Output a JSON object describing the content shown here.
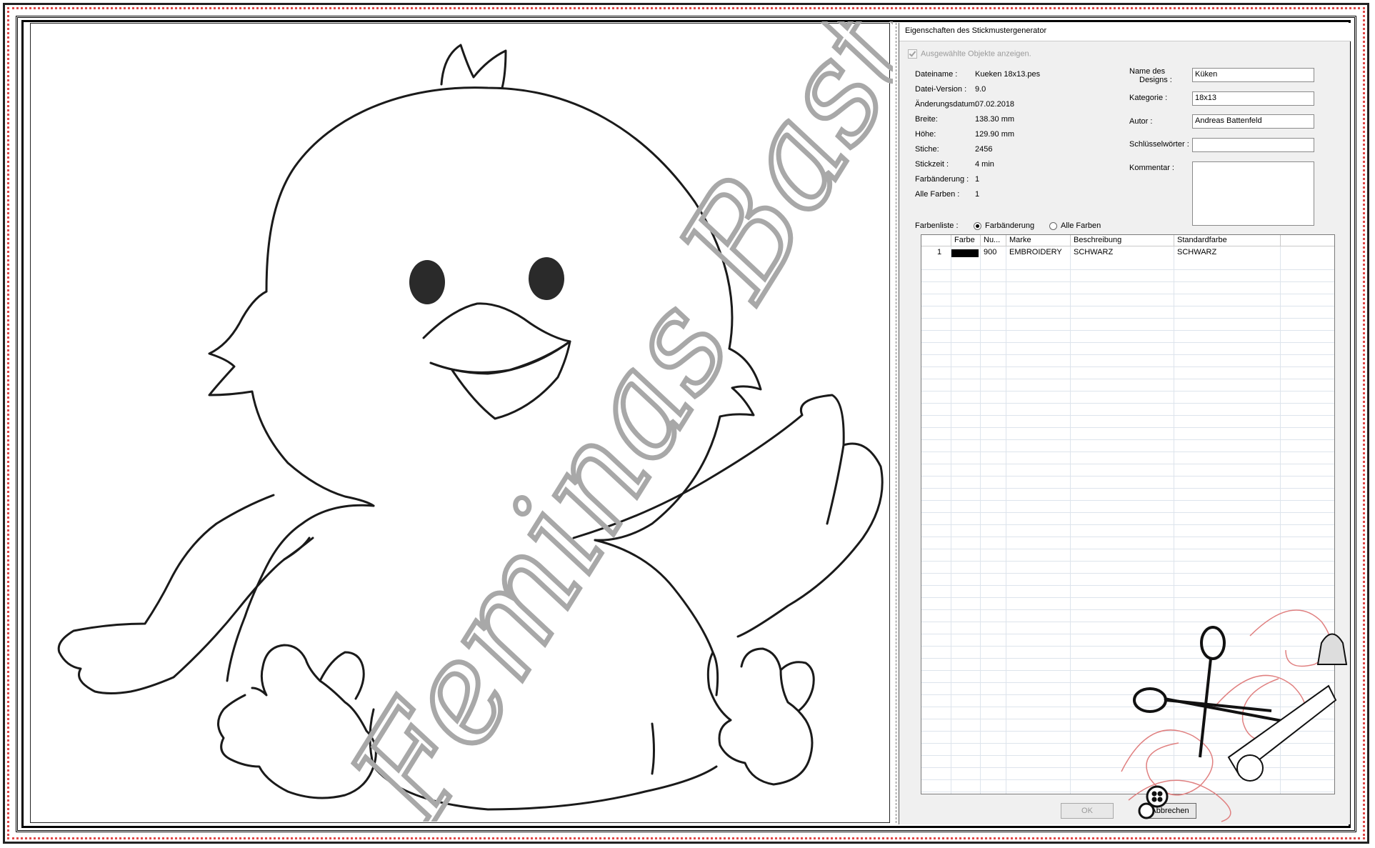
{
  "dialog": {
    "title": "Eigenschaften des Stickmustergenerator",
    "show_selected_label": "Ausgewählte Objekte anzeigen.",
    "info": [
      {
        "label": "Dateiname :",
        "value": "Kueken 18x13.pes"
      },
      {
        "label": "Datei-Version :",
        "value": "9.0"
      },
      {
        "label": "Änderungsdatum:",
        "value": "07.02.2018"
      },
      {
        "label": "Breite:",
        "value": "138.30 mm"
      },
      {
        "label": "Höhe:",
        "value": "129.90 mm"
      },
      {
        "label": "Stiche:",
        "value": "2456"
      },
      {
        "label": "Stickzeit :",
        "value": "4 min"
      },
      {
        "label": "Farbänderung :",
        "value": "1"
      },
      {
        "label": "Alle Farben :",
        "value": "1"
      }
    ],
    "fields": {
      "design_name": {
        "label_line1": "Name des",
        "label_line2": "Designs :",
        "value": "Küken"
      },
      "category": {
        "label": "Kategorie :",
        "value": "18x13"
      },
      "author": {
        "label": "Autor :",
        "value": "Andreas Battenfeld"
      },
      "keywords": {
        "label": "Schlüsselwörter :",
        "value": ""
      },
      "comment": {
        "label": "Kommentar :",
        "value": ""
      }
    },
    "color_list": {
      "label": "Farbenliste :",
      "option_change": "Farbänderung",
      "option_all": "Alle Farben",
      "selected": "Farbänderung"
    },
    "table": {
      "headers": [
        "",
        "Farbe",
        "Nu...",
        "Marke",
        "Beschreibung",
        "Standardfarbe"
      ],
      "rows": [
        {
          "index": "1",
          "color": "#000000",
          "number": "900",
          "brand": "EMBROIDERY",
          "description": "SCHWARZ",
          "default_color": "SCHWARZ"
        }
      ]
    },
    "buttons": {
      "ok": "OK",
      "cancel": "Abbrechen"
    }
  },
  "watermark": {
    "text": "Feminas Bastellerlei"
  },
  "colors": {
    "frame_dots": "#e04848",
    "dialog_bg": "#f0f0f0",
    "stitch": "#1a1a1a"
  }
}
